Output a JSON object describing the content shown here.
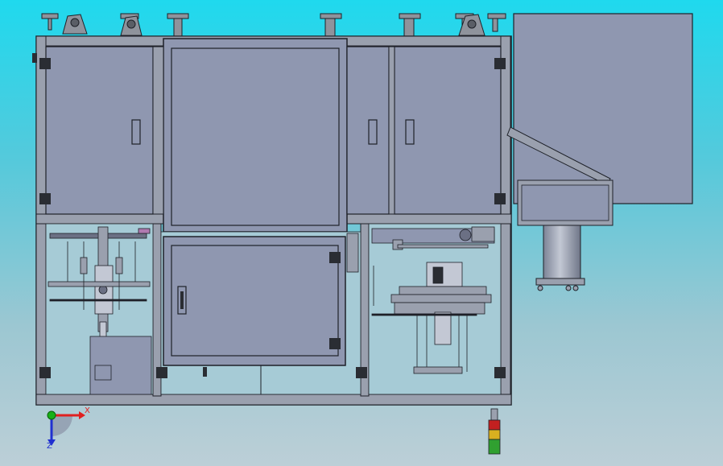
{
  "colors": {
    "background_top": "#1fd9ee",
    "background_bottom": "#bccfd7",
    "panel": "#8f97b0",
    "frame": "#9aa0ae",
    "outline": "#1e2128",
    "glass": "#a6cbd6",
    "axis_x": "#e02020",
    "axis_y": "#18b018",
    "axis_z": "#2030d0",
    "stack_light_red": "#c22020",
    "stack_light_amber": "#d8b020",
    "stack_light_green": "#30a030"
  },
  "triad": {
    "x_label": "X",
    "z_label": "Z"
  }
}
